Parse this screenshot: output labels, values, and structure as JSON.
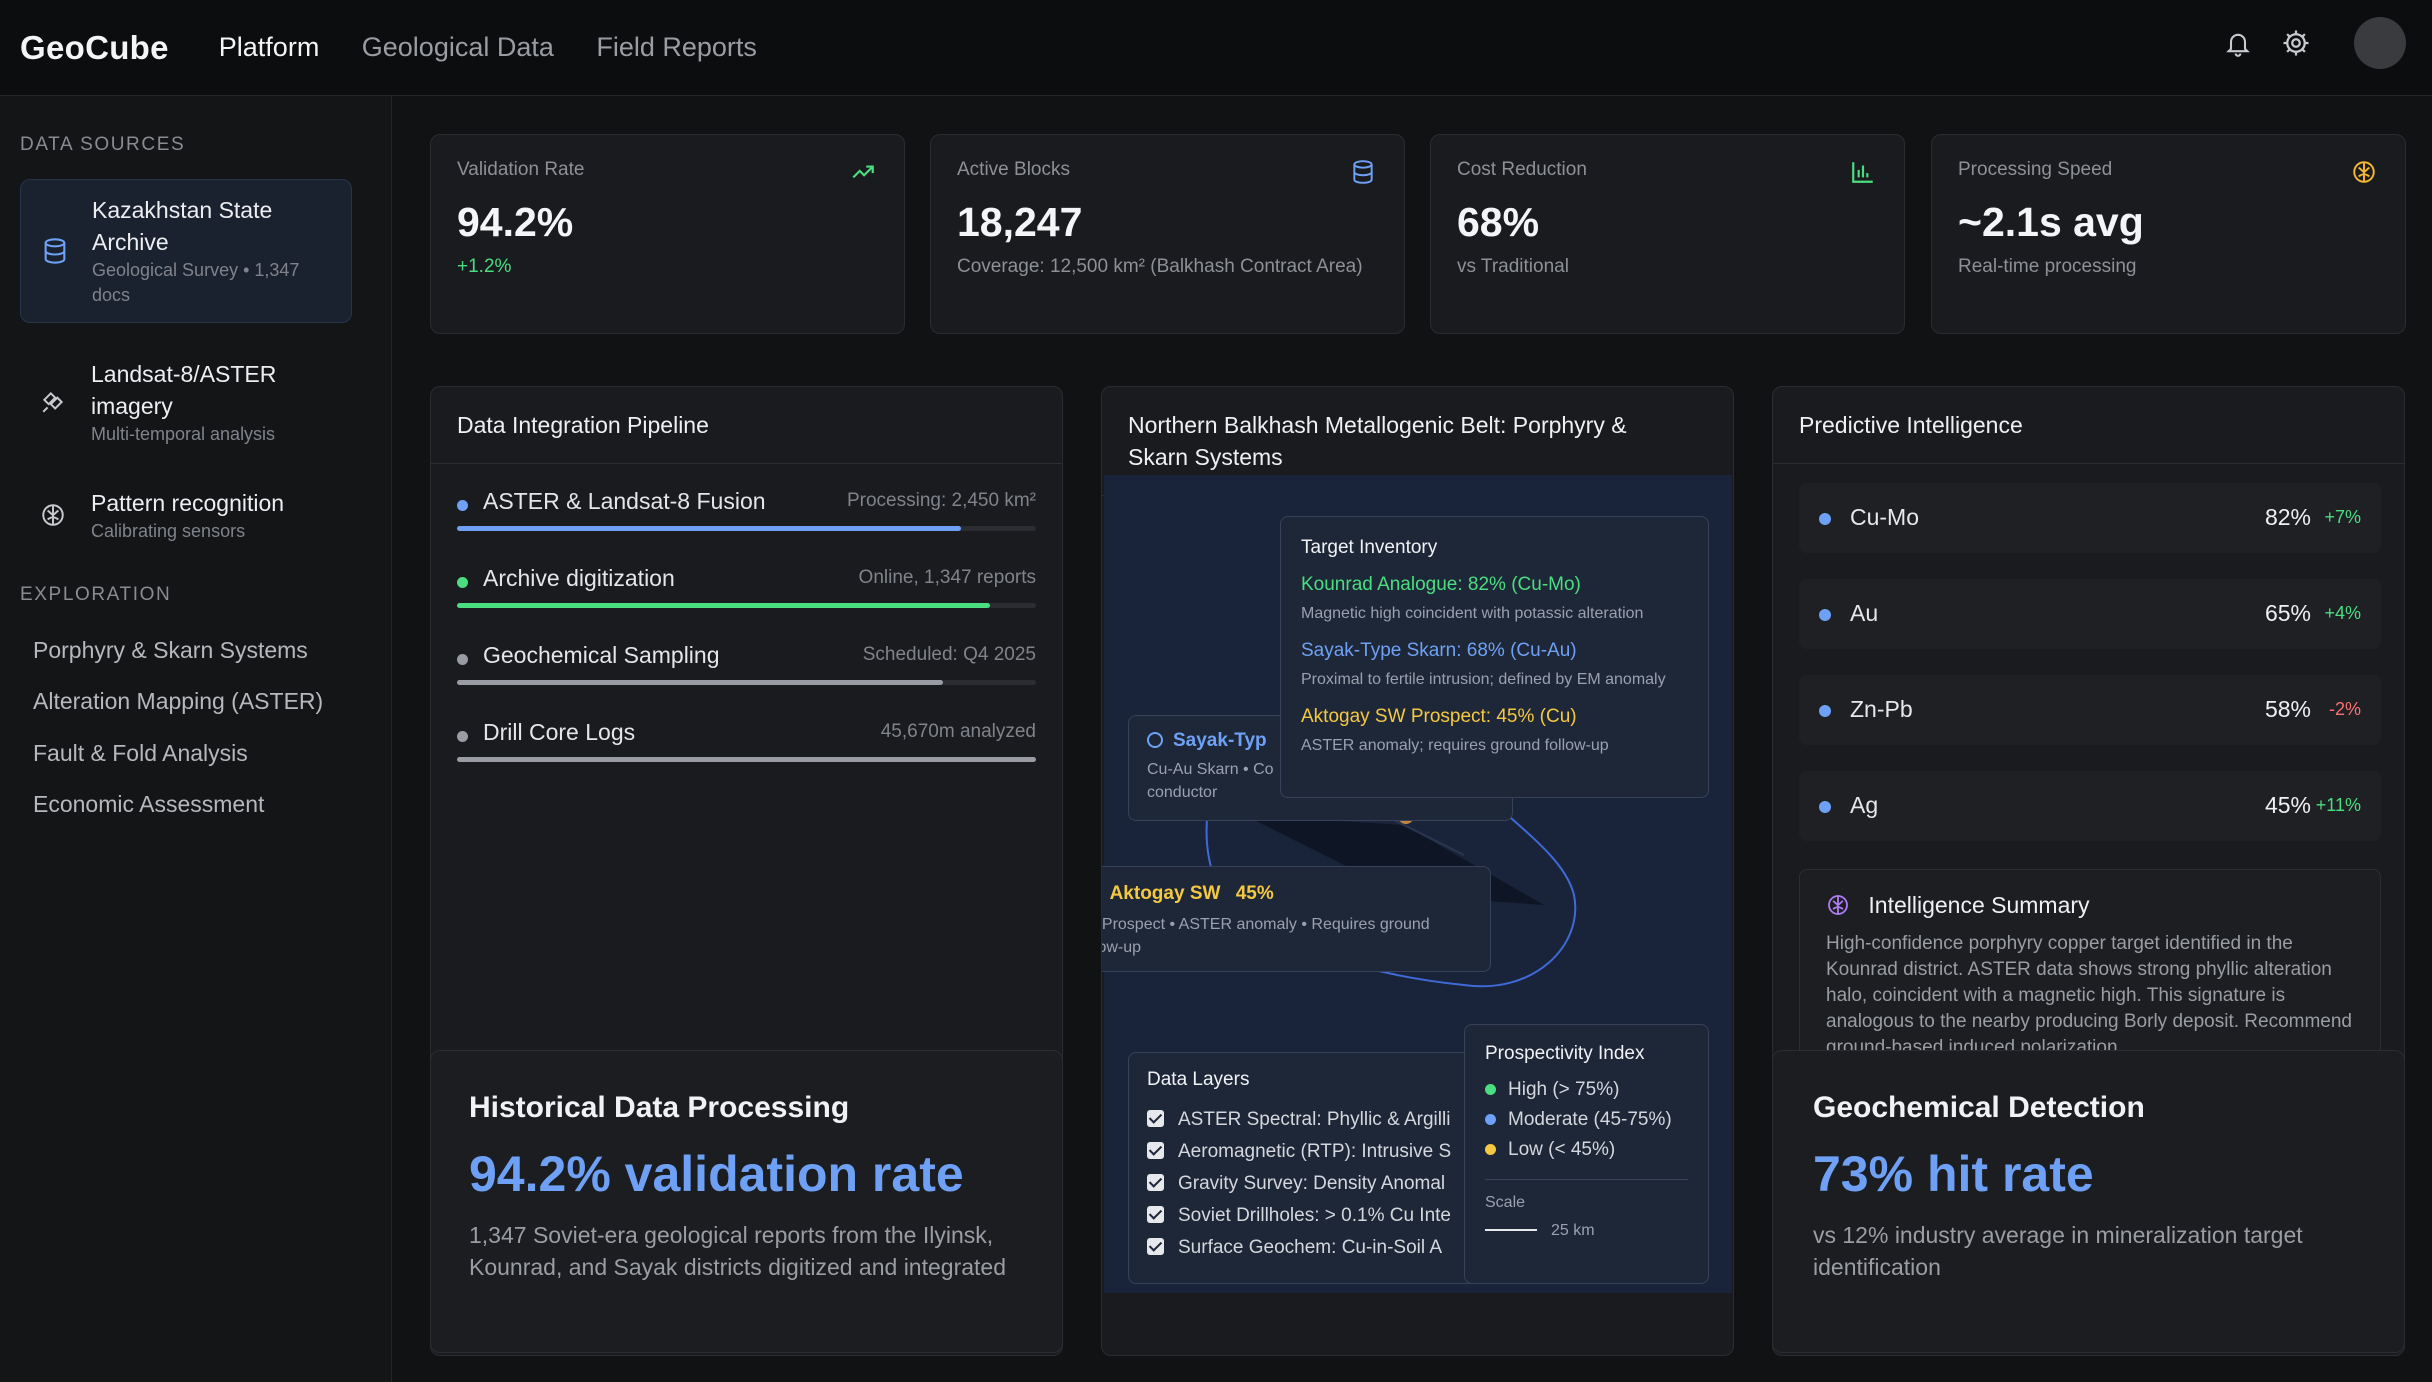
{
  "app": {
    "logo": "GeoCube",
    "nav": [
      "Platform",
      "Geological Data",
      "Field Reports"
    ]
  },
  "sidebar": {
    "data_sources_heading": "DATA SOURCES",
    "sources": [
      {
        "title": "Kazakhstan State Archive",
        "subtitle": "Geological Survey • 1,347 docs",
        "icon": "database-icon"
      },
      {
        "title": "Landsat-8/ASTER imagery",
        "subtitle": "Multi-temporal analysis",
        "icon": "satellite-icon"
      },
      {
        "title": "Pattern recognition",
        "subtitle": "Calibrating sensors",
        "icon": "brain-icon"
      }
    ],
    "exploration_heading": "EXPLORATION",
    "exploration": [
      "Porphyry & Skarn Systems",
      "Alteration Mapping (ASTER)",
      "Fault & Fold Analysis",
      "Economic Assessment"
    ]
  },
  "stats": [
    {
      "label": "Validation Rate",
      "value": "94.2%",
      "sub": "+1.2%",
      "icon": "trending-up-icon",
      "icon_color": "#4ade80"
    },
    {
      "label": "Active Blocks",
      "value": "18,247",
      "sub": "Coverage: 12,500 km² (Balkhash Contract Area)",
      "icon": "database-icon",
      "icon_color": "#6ea1f5"
    },
    {
      "label": "Cost Reduction",
      "value": "68%",
      "sub": "vs Traditional",
      "icon": "bar-chart-icon",
      "icon_color": "#4ade80"
    },
    {
      "label": "Processing Speed",
      "value": "~2.1s avg",
      "sub": "Real-time processing",
      "icon": "cpu-icon",
      "icon_color": "#f5b731"
    }
  ],
  "pipeline": {
    "title": "Data Integration Pipeline",
    "rows": [
      {
        "name": "ASTER & Landsat-8 Fusion",
        "status": "Processing: 2,450 km²",
        "dot": "#6ea1f5",
        "bar": "#6ea1f5",
        "progress": 0.87
      },
      {
        "name": "Archive digitization",
        "status": "Online, 1,347 reports",
        "dot": "#4ade80",
        "bar": "#4ade80",
        "progress": 0.92
      },
      {
        "name": "Geochemical Sampling",
        "status": "Scheduled: Q4 2025",
        "dot": "#9a9ca3",
        "bar": "#9a9ca3",
        "progress": 0.84
      },
      {
        "name": "Drill Core Logs",
        "status": "45,670m analyzed",
        "dot": "#9a9ca3",
        "bar": "#9a9ca3",
        "progress": 1.0
      }
    ],
    "highlight": {
      "title": "Historical Data Processing",
      "value": "94.2% validation rate",
      "desc": "1,347 Soviet-era geological reports from the Ilyinsk, Kounrad, and Sayak districts digitized and integrated"
    }
  },
  "map": {
    "title": "Northern Balkhash Metallogenic Belt: Porphyry & Skarn Systems",
    "inventory": {
      "heading": "Target Inventory",
      "items": [
        {
          "name": "Kounrad Analogue: 82% (Cu-Mo)",
          "desc": "Magnetic high coincident with potassic alteration",
          "color": "#4ade80"
        },
        {
          "name": "Sayak-Type Skarn: 68% (Cu-Au)",
          "desc": "Proximal to fertile intrusion; defined by EM anomaly",
          "color": "#6ea1f5"
        },
        {
          "name": "Aktogay SW Prospect: 45% (Cu)",
          "desc": "ASTER anomaly; requires ground follow-up",
          "color": "#f5c842"
        }
      ]
    },
    "sayak_tip": {
      "title": "Sayak-Typ",
      "desc1": "Cu-Au Skarn • Co",
      "desc2": "conductor"
    },
    "aktogay_tip": {
      "title": "Aktogay SW",
      "pct": "45%",
      "desc": "Cu Prospect • ASTER anomaly • Requires ground follow-up"
    },
    "layers": {
      "heading": "Data Layers",
      "items": [
        "ASTER Spectral: Phyllic & Argilli",
        "Aeromagnetic (RTP): Intrusive S",
        "Gravity Survey: Density Anomal",
        "Soviet Drillholes: > 0.1% Cu Inte",
        "Surface Geochem: Cu-in-Soil A"
      ]
    },
    "legend": {
      "heading": "Prospectivity Index",
      "items": [
        {
          "label": "High (> 75%)",
          "color": "#4ade80"
        },
        {
          "label": "Moderate (45-75%)",
          "color": "#6ea1f5"
        },
        {
          "label": "Low (< 45%)",
          "color": "#f5c842"
        }
      ],
      "scale_label": "Scale",
      "scale_value": "25 km"
    }
  },
  "predictive": {
    "title": "Predictive Intelligence",
    "rows": [
      {
        "element": "Cu-Mo",
        "pct": "82%",
        "delta": "+7%",
        "delta_color": "#4ade80"
      },
      {
        "element": "Au",
        "pct": "65%",
        "delta": "+4%",
        "delta_color": "#4ade80"
      },
      {
        "element": "Zn-Pb",
        "pct": "58%",
        "delta": "-2%",
        "delta_color": "#f87171"
      },
      {
        "element": "Ag",
        "pct": "45%",
        "delta": "+11%",
        "delta_color": "#4ade80"
      }
    ],
    "summary": {
      "title": "Intelligence Summary",
      "text": "High-confidence porphyry copper target identified in the Kounrad district. ASTER data shows strong phyllic alteration halo, coincident with a magnetic high. This signature is analogous to the nearby producing Borly deposit. Recommend ground-based induced polarization"
    },
    "highlight": {
      "title": "Geochemical Detection",
      "value": "73% hit rate",
      "desc": "vs 12% industry average in mineralization target identification"
    }
  }
}
